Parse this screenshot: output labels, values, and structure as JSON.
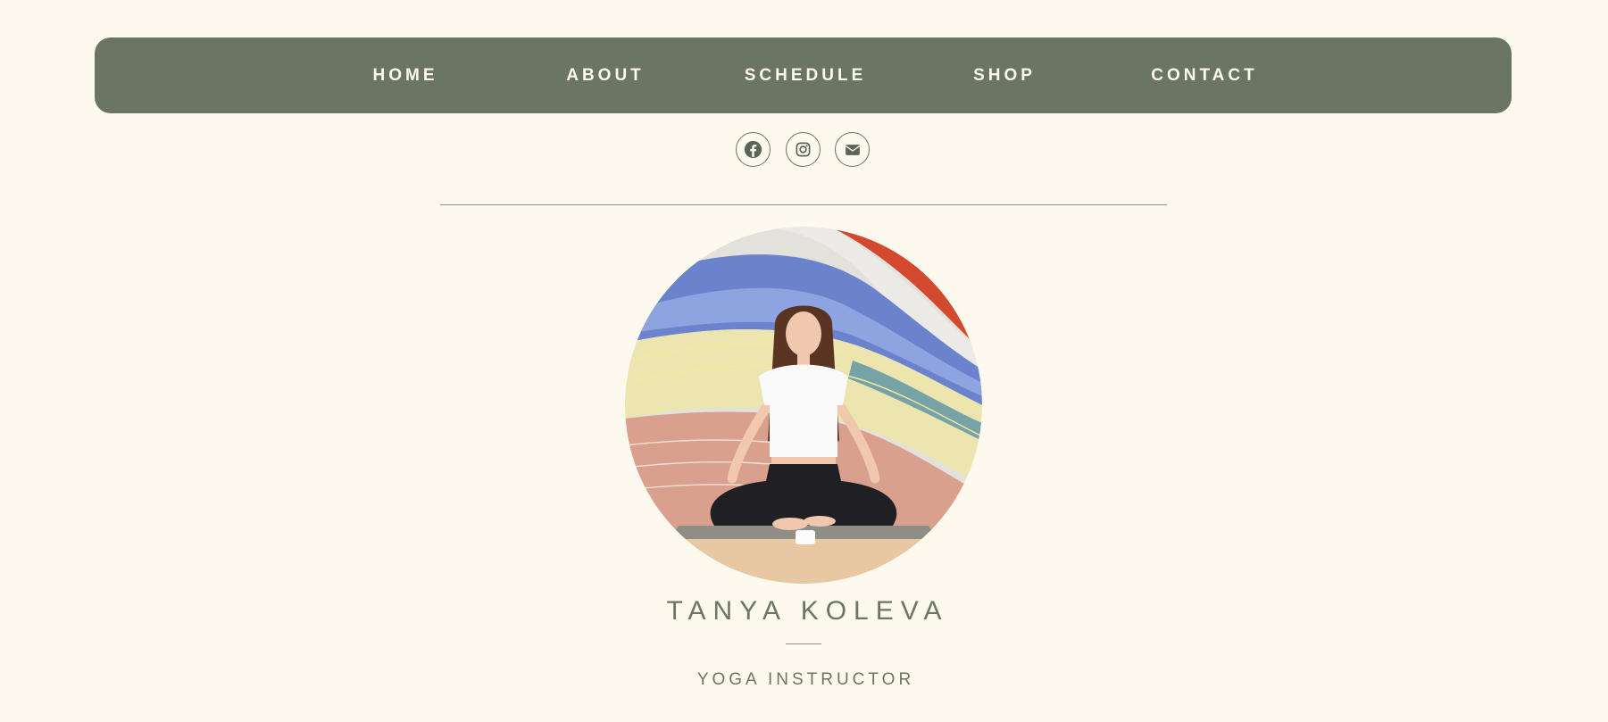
{
  "nav": {
    "items": [
      {
        "label": "HOME"
      },
      {
        "label": "ABOUT"
      },
      {
        "label": "SCHEDULE"
      },
      {
        "label": "SHOP"
      },
      {
        "label": "CONTACT"
      }
    ]
  },
  "social": {
    "icons": [
      "facebook-icon",
      "instagram-icon",
      "email-icon"
    ]
  },
  "colors": {
    "background": "#fdf9ee",
    "nav_background": "#6b7563",
    "nav_text": "#fdf9ee",
    "accent": "#6b7563"
  },
  "profile": {
    "name": "TANYA KOLEVA",
    "title": "YOGA INSTRUCTOR"
  }
}
